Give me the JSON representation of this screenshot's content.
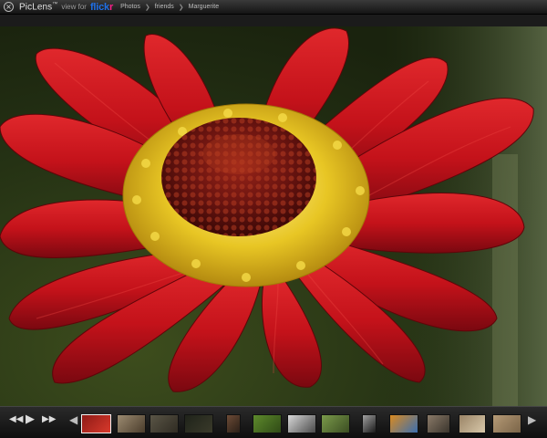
{
  "topbar": {
    "close_symbol": "×",
    "brand": "PicLens",
    "brand_tm": "™",
    "view_for": "view for",
    "flickr_a": "flick",
    "flickr_b": "r",
    "breadcrumbs": [
      "Photos",
      "friends",
      "Marguerite"
    ]
  },
  "icons": {
    "close": "close-icon",
    "rewind": "rewind-icon",
    "play": "play-icon",
    "fast_forward": "fast-forward-icon",
    "prev": "chevron-left-icon",
    "next": "chevron-right-icon"
  },
  "filmstrip": {
    "controls": {
      "rewind": "◀◀",
      "play": "▶",
      "fast_forward": "▶▶",
      "prev": "◀",
      "next": "▶"
    },
    "thumbnails": [
      {
        "subject": "red daisy",
        "colors": [
          "#8e1a16",
          "#d93a2c"
        ],
        "selected": true
      },
      {
        "subject": "insect",
        "colors": [
          "#9c8b71",
          "#4a3c2b"
        ]
      },
      {
        "subject": "bug on ground",
        "colors": [
          "#5a5546",
          "#2f2b22"
        ]
      },
      {
        "subject": "dark macro",
        "colors": [
          "#1f231a",
          "#3a3a2a"
        ]
      },
      {
        "subject": "portrait",
        "colors": [
          "#6d4b36",
          "#2a1f17"
        ]
      },
      {
        "subject": "green leaf bug",
        "colors": [
          "#5e8a2c",
          "#2f4a16"
        ]
      },
      {
        "subject": "white flower",
        "colors": [
          "#d8d8d8",
          "#4a4a4a"
        ]
      },
      {
        "subject": "beetle on leaf",
        "colors": [
          "#7a9a4a",
          "#3b4d22"
        ]
      },
      {
        "subject": "black and white",
        "colors": [
          "#a0a0a0",
          "#1a1a1a"
        ]
      },
      {
        "subject": "orange butterfly",
        "colors": [
          "#d98a20",
          "#3b6fb0"
        ]
      },
      {
        "subject": "mechanical object",
        "colors": [
          "#8a7a68",
          "#3a342c"
        ]
      },
      {
        "subject": "boxes",
        "colors": [
          "#9a8466",
          "#d8c8aa"
        ]
      },
      {
        "subject": "wood texture",
        "colors": [
          "#b59a76",
          "#7a6448"
        ]
      }
    ]
  },
  "colors": {
    "petal": "#c8161d",
    "petal_dark": "#7d0a10",
    "pollen": "#e6c62a",
    "center": "#6d1712"
  }
}
